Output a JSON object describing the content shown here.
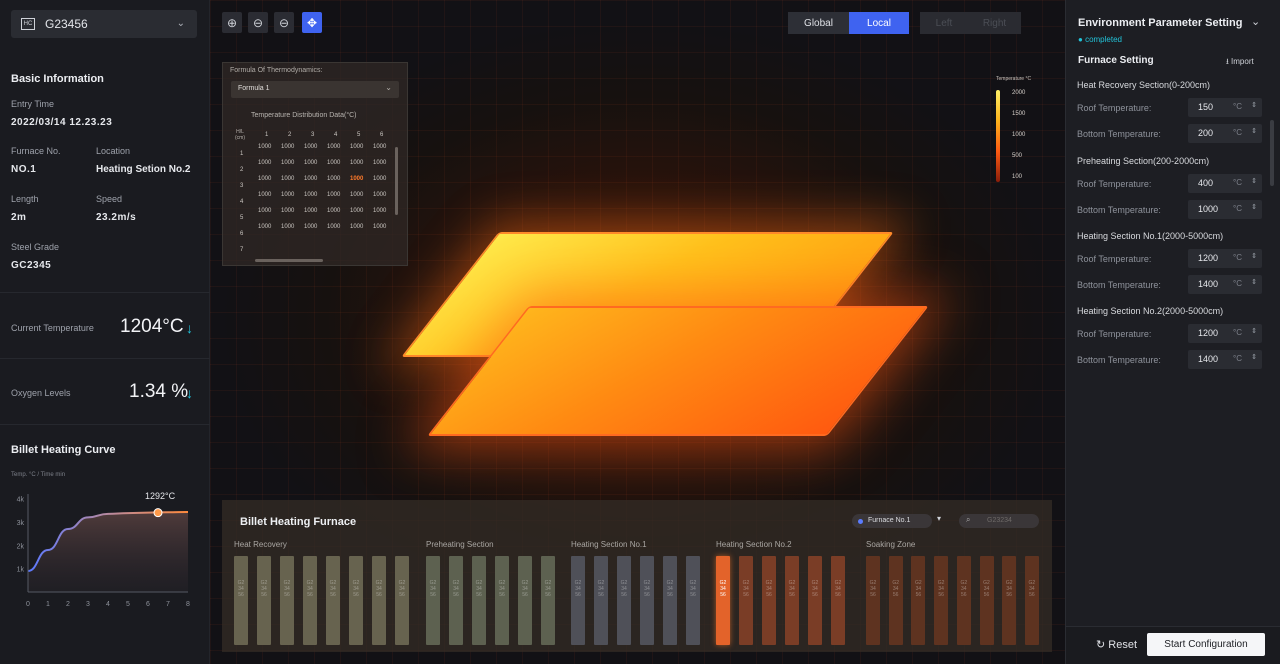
{
  "left": {
    "selector": {
      "code": "G23456",
      "logo": "HC"
    },
    "basic": {
      "title": "Basic Information",
      "entry_label": "Entry Time",
      "entry": "2022/03/14 12.23.23",
      "furnace_label": "Furnace No.",
      "furnace": "NO.1",
      "location_label": "Location",
      "location": "Heating Setion No.2",
      "length_label": "Length",
      "length": "2m",
      "speed_label": "Speed",
      "speed": "23.2m/s",
      "grade_label": "Steel Grade",
      "grade": "GC2345"
    },
    "metrics": {
      "temp_label": "Current Temperature",
      "temp": "1204°C",
      "oxy_label": "Oxygen Levels",
      "oxy": "1.34 %",
      "arrow": "↓"
    },
    "curve": {
      "title": "Billet Heating Curve",
      "axis_note": "Temp. °C / Time  min",
      "peak": "1292°C"
    }
  },
  "chart_data": {
    "type": "line",
    "x": [
      0,
      1,
      2,
      3,
      4,
      5,
      6,
      7,
      8
    ],
    "y": [
      900,
      1800,
      2700,
      3200,
      3350,
      3380,
      3400,
      3420,
      3430
    ],
    "ytick_labels": [
      "1k",
      "2k",
      "3k",
      "4k"
    ],
    "xtick_labels": [
      "0",
      "1",
      "2",
      "3",
      "4",
      "5",
      "6",
      "7",
      "8"
    ],
    "ylim": [
      0,
      4200
    ],
    "xlim": [
      0,
      8
    ],
    "marker_x": 6.5
  },
  "toolbar": {
    "zoom_in": "⊕",
    "zoom_out": "⊖",
    "zoom_reset": "⊖",
    "move": "✥",
    "global": "Global",
    "local": "Local",
    "left": "Left",
    "right": "Right"
  },
  "formula": {
    "title": "Formula Of Thermodynamics:",
    "selected": "Formula 1",
    "table_title": "Temperature Distribution Data(°C)",
    "corner": "H/L (cm)",
    "cols": [
      "1",
      "2",
      "3",
      "4",
      "5",
      "6"
    ],
    "rows": [
      "1",
      "2",
      "3",
      "4",
      "5",
      "6",
      "7"
    ],
    "value": "1000"
  },
  "legend": {
    "title": "Temperature °C",
    "ticks": [
      "2000",
      "1500",
      "1000",
      "500",
      "100"
    ]
  },
  "furnace": {
    "title": "Billet Heating Furnace",
    "select": "Furnace No.1",
    "search": "G23234",
    "sections": [
      {
        "name": "Heat Recovery",
        "count": 8
      },
      {
        "name": "Preheating Section",
        "count": 6
      },
      {
        "name": "Heating Section No.1",
        "count": 6
      },
      {
        "name": "Heating Section No.2",
        "count": 6
      },
      {
        "name": "Soaking Zone",
        "count": 8
      }
    ],
    "slab_code": "G23456"
  },
  "right": {
    "title": "Environment Parameter Setting",
    "status": "completed",
    "furnace_title": "Furnace Setting",
    "import": "Import",
    "sections": [
      {
        "name": "Heat Recovery Section(0-200cm)",
        "roof": "150",
        "bottom": "200"
      },
      {
        "name": "Preheating Section(200-2000cm)",
        "roof": "400",
        "bottom": "1000"
      },
      {
        "name": "Heating Section No.1(2000-5000cm)",
        "roof": "1200",
        "bottom": "1400"
      },
      {
        "name": "Heating Section No.2(2000-5000cm)",
        "roof": "1200",
        "bottom": "1400"
      }
    ],
    "roof_label": "Roof Temperature:",
    "bottom_label": "Bottom Temperature:",
    "unit": "°C",
    "reset": "Reset",
    "start": "Start Configuration"
  },
  "colors": {
    "accent": "#3f63f0",
    "hot": "#ff7a1a",
    "teal": "#22c3d9",
    "active_slab": "#e3632a"
  }
}
